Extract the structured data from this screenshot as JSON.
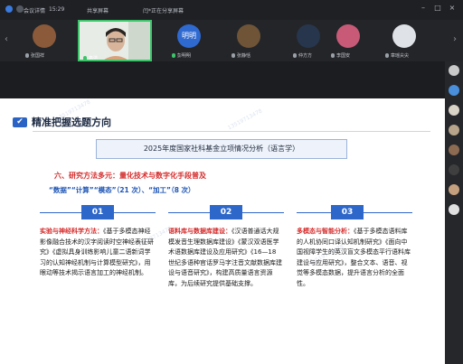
{
  "topbar": {
    "app_label": "会议详情",
    "time": "15:29",
    "room_label": "共享屏幕",
    "sharer_text": "闫*正在分享屏幕"
  },
  "participants": [
    {
      "name": "张国祥",
      "color": "#8a5a3a"
    },
    {
      "name": "高洁",
      "color": "#c9b8a0",
      "video": true
    },
    {
      "name": "彭明明",
      "avatar_text": "明明",
      "color": "#2f6ad1"
    },
    {
      "name": "张静恬",
      "color": "#6f5438"
    },
    {
      "name": "仲方方",
      "color": "#27364d"
    },
    {
      "name": "李国安",
      "color": "#c85a77"
    },
    {
      "name": "章瑶尖尖",
      "color": "#dfe3e8"
    }
  ],
  "slide": {
    "title": "精准把握选题方向",
    "banner": "2025年度国家社科基金立项情况分析（语言学）",
    "section_title": "六、研究方法多元：量化技术与数字化手段普及",
    "section_sub_quoted": "“数据”“计算”“模态”（21 次）、“加工”（8 次）",
    "columns": [
      {
        "num": "01",
        "lead": "实验与神经科学方法：",
        "text": "《基于多模态神经影像融合技术的汉字阅读时空神经表征研究》《虚拟具身训练影响儿童二语新词学习的认知神经机制与计算模型研究》，用眼动等技术揭示语言加工的神经机制。"
      },
      {
        "num": "02",
        "lead": "语料库与数据库建设：",
        "text": "《汉语普通话大规模发音生理数据库建设》《蒙汉双语医学术语数据库建设及应用研究》《16—18 世纪多语种官话罗马字注音文献数据库建设与语音研究》，构建高质量语言资源库，为后续研究提供基础支撑。"
      },
      {
        "num": "03",
        "lead": "多模态与智能分析：",
        "text": "《基于多模态语料库的人机协同口译认知机制研究》《面向中国视障学生的英汉盲文多模态平行语料库建设与应用研究》，整合文本、语音、视觉等多模态数据，提升语言分析的全面性。"
      }
    ],
    "watermark": "13519713478"
  }
}
